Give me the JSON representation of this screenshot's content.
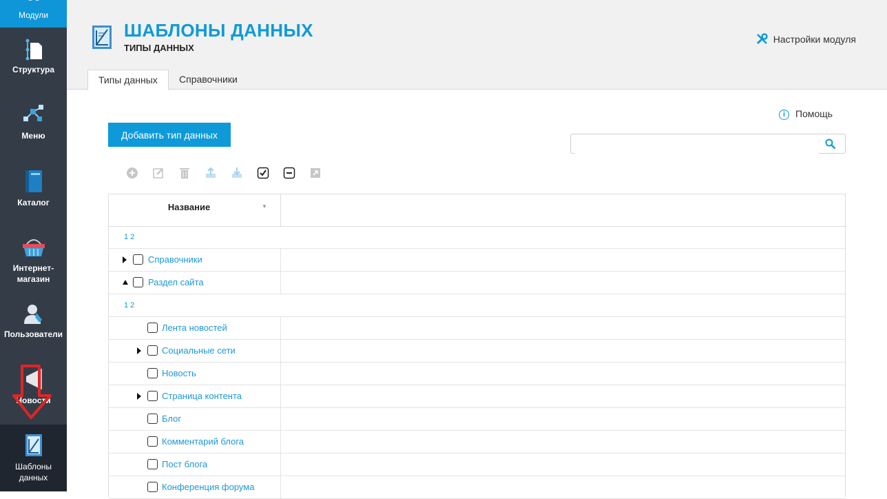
{
  "sidebar": {
    "items": [
      {
        "label": "Модули",
        "icon": "modules-icon"
      },
      {
        "label": "Структура",
        "icon": "structure-icon"
      },
      {
        "label": "Меню",
        "icon": "menu-icon"
      },
      {
        "label": "Каталог",
        "icon": "catalog-icon"
      },
      {
        "label": "Интернет-",
        "label2": "магазин",
        "icon": "basket-icon"
      },
      {
        "label": "Пользователи",
        "icon": "user-icon"
      },
      {
        "label": "Новости",
        "icon": "news-icon"
      },
      {
        "label": "Шаблоны",
        "label2": "данных",
        "icon": "templates-icon"
      }
    ]
  },
  "header": {
    "title": "ШАБЛОНЫ ДАННЫХ",
    "subtitle": "ТИПЫ ДАННЫХ",
    "settings_label": "Настройки модуля",
    "tabs": [
      {
        "label": "Типы данных",
        "active": true
      },
      {
        "label": "Справочники",
        "active": false
      }
    ]
  },
  "content": {
    "help_label": "Помощь",
    "add_button": "Добавить тип данных",
    "search_placeholder": ""
  },
  "table": {
    "column_name": "Название",
    "pager": [
      "1",
      "2"
    ],
    "top_rows": [
      {
        "label": "Справочники",
        "expander": "collapsed"
      },
      {
        "label": "Раздел сайта",
        "expander": "expanded"
      }
    ],
    "child_rows": [
      {
        "label": "Лента новостей",
        "expander": "none"
      },
      {
        "label": "Социальные сети",
        "expander": "collapsed"
      },
      {
        "label": "Новость",
        "expander": "none"
      },
      {
        "label": "Страница контента",
        "expander": "collapsed"
      },
      {
        "label": "Блог",
        "expander": "none"
      },
      {
        "label": "Комментарий блога",
        "expander": "none"
      },
      {
        "label": "Пост блога",
        "expander": "none"
      },
      {
        "label": "Конференция форума",
        "expander": "none"
      }
    ]
  },
  "colors": {
    "accent": "#0e9ad9",
    "sidebar_bg": "#343c48",
    "annotation_arrow": "#e02424"
  }
}
